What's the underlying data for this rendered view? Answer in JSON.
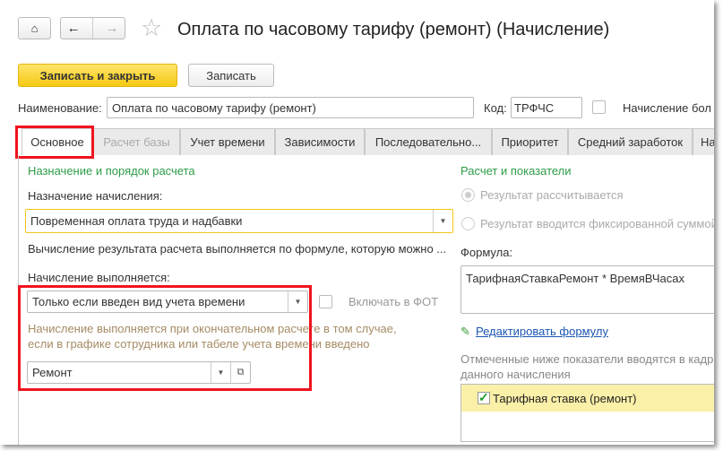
{
  "header": {
    "title": "Оплата по часовому тарифу (ремонт) (Начисление)"
  },
  "toolbar": {
    "save_close": "Записать и закрыть",
    "save": "Записать"
  },
  "fields": {
    "name_label": "Наименование:",
    "name_value": "Оплата по часовому тарифу (ремонт)",
    "code_label": "Код:",
    "code_value": "ТРФЧС",
    "sick_label": "Начисление бол"
  },
  "tabs": [
    {
      "label": "Основное"
    },
    {
      "label": "Расчет базы"
    },
    {
      "label": "Учет времени"
    },
    {
      "label": "Зависимости"
    },
    {
      "label": "Последовательно..."
    },
    {
      "label": "Приоритет"
    },
    {
      "label": "Средний заработок"
    },
    {
      "label": "На"
    }
  ],
  "left": {
    "heading": "Назначение и порядок расчета",
    "purpose_label": "Назначение начисления:",
    "purpose_value": "Повременная оплата труда и надбавки",
    "formula_note": "Вычисление результата расчета выполняется по формуле, которую можно ...",
    "exec_label": "Начисление выполняется:",
    "exec_value": "Только если введен вид учета времени",
    "fot_label": "Включать в ФОТ",
    "hint1": "Начисление выполняется при окончательном расчете в том случае,",
    "hint2": "если в графике сотрудника или табеле учета времени введено",
    "time_type": "Ремонт"
  },
  "right": {
    "heading": "Расчет и показатели",
    "radio1": "Результат рассчитывается",
    "radio2": "Результат вводится фиксированной суммой",
    "formula_label": "Формула:",
    "formula": "ТарифнаяСтавкаРемонт * ВремяВЧасах",
    "edit_link": "Редактировать формулу",
    "note1": "Отмеченные ниже показатели вводятся в кадр",
    "note2": "данного начисления",
    "indicator": "Тарифная ставка (ремонт)"
  }
}
